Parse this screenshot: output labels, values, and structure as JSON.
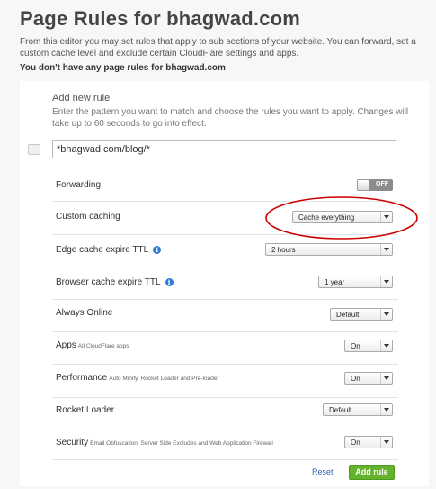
{
  "header": {
    "title": "Page Rules for bhagwad.com",
    "intro": "From this editor you may set rules that apply to sub sections of your website. You can forward, set a custom cache level and exclude certain CloudFlare settings and apps.",
    "no_rules_message": "You don't have any page rules for bhagwad.com"
  },
  "add_rule": {
    "heading": "Add new rule",
    "description": "Enter the pattern you want to match and choose the rules you want to apply. Changes will take up to 60 seconds to go into effect.",
    "pattern_value": "*bhagwad.com/blog/*"
  },
  "rules": {
    "forwarding": {
      "label": "Forwarding",
      "toggle_state": "OFF"
    },
    "custom_caching": {
      "label": "Custom caching",
      "value": "Cache everything"
    },
    "edge_cache_ttl": {
      "label": "Edge cache expire TTL",
      "value": "2 hours",
      "icon": "info-icon"
    },
    "browser_cache_ttl": {
      "label": "Browser cache expire TTL",
      "value": "1 year",
      "icon": "info-icon"
    },
    "always_online": {
      "label": "Always Online",
      "value": "Default"
    },
    "apps": {
      "label": "Apps",
      "sub": "All CloudFlare apps",
      "value": "On"
    },
    "performance": {
      "label": "Performance",
      "sub": "Auto Minify, Rocket Loader and Pre-loader",
      "value": "On"
    },
    "rocket_loader": {
      "label": "Rocket Loader",
      "value": "Default"
    },
    "security": {
      "label": "Security",
      "sub": "Email Obfuscation, Server Side Excludes and Web Application Firewall",
      "value": "On"
    }
  },
  "actions": {
    "reset_label": "Reset",
    "add_label": "Add rule"
  },
  "colors": {
    "accent_green": "#62b22c",
    "link_blue": "#2d6ab0",
    "annotation_red": "#cc0000",
    "info_blue": "#2f7bd6"
  }
}
